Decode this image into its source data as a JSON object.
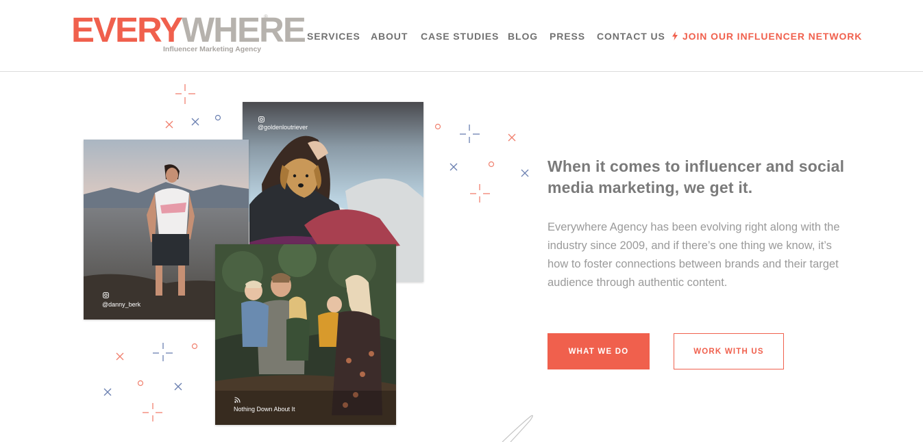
{
  "brand": {
    "logo_every": "EVERY",
    "logo_where": "WHERE",
    "logo_reg": "®",
    "tagline": "Influencer Marketing Agency",
    "primary_color": "#f0604d",
    "accent_blue": "#6a7fb0",
    "logo_gray": "#b6b2ad"
  },
  "nav": {
    "items": [
      {
        "label": "SERVICES"
      },
      {
        "label": "ABOUT"
      },
      {
        "label": "CASE STUDIES"
      },
      {
        "label": "BLOG"
      },
      {
        "label": "PRESS"
      },
      {
        "label": "CONTACT US"
      }
    ],
    "cta": {
      "label": "JOIN OUR INFLUENCER NETWORK",
      "icon": "lightning-bolt-icon"
    }
  },
  "photos": {
    "left": {
      "handle": "@danny_berk",
      "icon": "instagram-icon"
    },
    "top": {
      "handle": "@goldenloutriever",
      "icon": "instagram-icon"
    },
    "bottom": {
      "handle": "Nothing Down About It",
      "icon": "rss-icon"
    }
  },
  "hero": {
    "headline": "When it comes to influencer and social media marketing, we get it.",
    "body": "Everywhere Agency has been evolving right along with the industry since 2009, and if there’s one thing we know, it’s how to foster connections between brands and their target audience through authentic content.",
    "primary_button": "WHAT WE DO",
    "secondary_button": "WORK WITH US"
  }
}
